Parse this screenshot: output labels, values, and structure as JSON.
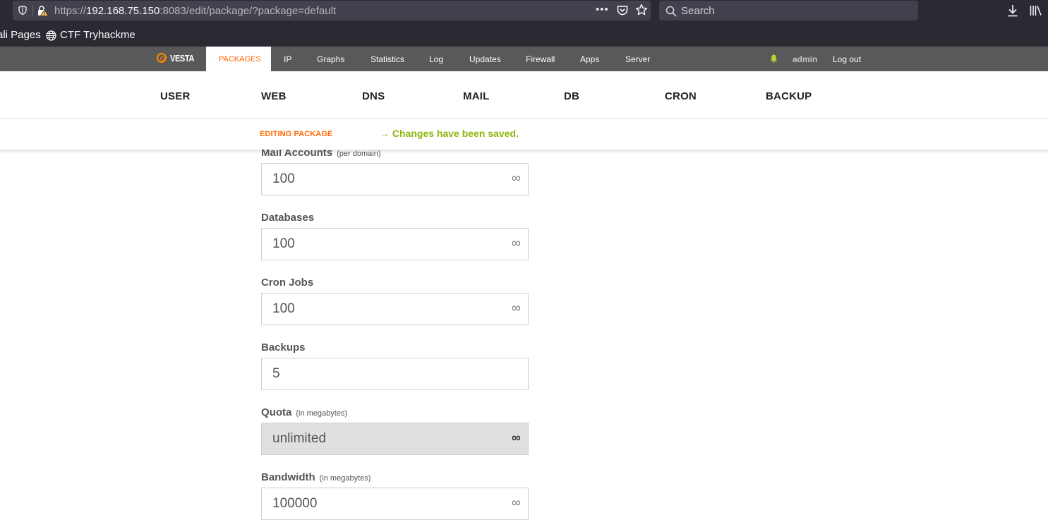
{
  "browser": {
    "url_prefix": "https://",
    "url_host": "192.168.75.150",
    "url_rest": ":8083/edit/package/?package=default",
    "search_placeholder": "Search",
    "bookmarks": [
      "ali Pages",
      "CTF Tryhackme"
    ]
  },
  "topnav": {
    "logo": "VESTA",
    "active": "PACKAGES",
    "items": [
      "IP",
      "Graphs",
      "Statistics",
      "Log",
      "Updates",
      "Firewall",
      "Apps",
      "Server"
    ],
    "user": "admin",
    "logout": "Log out"
  },
  "submenu": [
    "USER",
    "WEB",
    "DNS",
    "MAIL",
    "DB",
    "CRON",
    "BACKUP"
  ],
  "editbar": {
    "title": "EDITING PACKAGE",
    "message": "→ Changes have been saved."
  },
  "form": {
    "fields": [
      {
        "label": "Mail Accounts",
        "hint": "(per domain)",
        "value": "100",
        "unlimited_toggle": "∞"
      },
      {
        "label": "Databases",
        "hint": "",
        "value": "100",
        "unlimited_toggle": "∞"
      },
      {
        "label": "Cron Jobs",
        "hint": "",
        "value": "100",
        "unlimited_toggle": "∞"
      },
      {
        "label": "Backups",
        "hint": "",
        "value": "5",
        "unlimited_toggle": ""
      },
      {
        "label": "Quota",
        "hint": "(in megabytes)",
        "value": "unlimited",
        "unlimited_toggle": "∞"
      },
      {
        "label": "Bandwidth",
        "hint": "(in megabytes)",
        "value": "100000",
        "unlimited_toggle": "∞"
      }
    ]
  },
  "colors": {
    "accent_orange": "#ff6701",
    "success_green": "#8fb50e",
    "topnav_bg": "#595959"
  }
}
